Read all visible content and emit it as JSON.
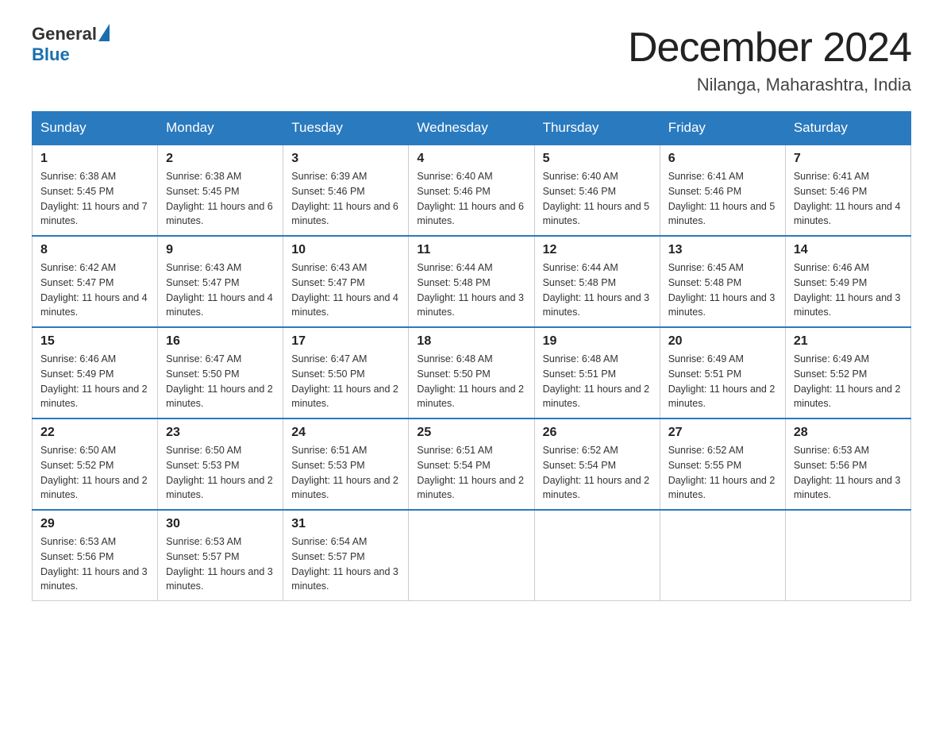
{
  "logo": {
    "text_general": "General",
    "text_blue": "Blue",
    "triangle_decoration": "▶"
  },
  "title": {
    "month_year": "December 2024",
    "location": "Nilanga, Maharashtra, India"
  },
  "weekdays": [
    "Sunday",
    "Monday",
    "Tuesday",
    "Wednesday",
    "Thursday",
    "Friday",
    "Saturday"
  ],
  "weeks": [
    [
      {
        "day": "1",
        "sunrise": "6:38 AM",
        "sunset": "5:45 PM",
        "daylight": "11 hours and 7 minutes."
      },
      {
        "day": "2",
        "sunrise": "6:38 AM",
        "sunset": "5:45 PM",
        "daylight": "11 hours and 6 minutes."
      },
      {
        "day": "3",
        "sunrise": "6:39 AM",
        "sunset": "5:46 PM",
        "daylight": "11 hours and 6 minutes."
      },
      {
        "day": "4",
        "sunrise": "6:40 AM",
        "sunset": "5:46 PM",
        "daylight": "11 hours and 6 minutes."
      },
      {
        "day": "5",
        "sunrise": "6:40 AM",
        "sunset": "5:46 PM",
        "daylight": "11 hours and 5 minutes."
      },
      {
        "day": "6",
        "sunrise": "6:41 AM",
        "sunset": "5:46 PM",
        "daylight": "11 hours and 5 minutes."
      },
      {
        "day": "7",
        "sunrise": "6:41 AM",
        "sunset": "5:46 PM",
        "daylight": "11 hours and 4 minutes."
      }
    ],
    [
      {
        "day": "8",
        "sunrise": "6:42 AM",
        "sunset": "5:47 PM",
        "daylight": "11 hours and 4 minutes."
      },
      {
        "day": "9",
        "sunrise": "6:43 AM",
        "sunset": "5:47 PM",
        "daylight": "11 hours and 4 minutes."
      },
      {
        "day": "10",
        "sunrise": "6:43 AM",
        "sunset": "5:47 PM",
        "daylight": "11 hours and 4 minutes."
      },
      {
        "day": "11",
        "sunrise": "6:44 AM",
        "sunset": "5:48 PM",
        "daylight": "11 hours and 3 minutes."
      },
      {
        "day": "12",
        "sunrise": "6:44 AM",
        "sunset": "5:48 PM",
        "daylight": "11 hours and 3 minutes."
      },
      {
        "day": "13",
        "sunrise": "6:45 AM",
        "sunset": "5:48 PM",
        "daylight": "11 hours and 3 minutes."
      },
      {
        "day": "14",
        "sunrise": "6:46 AM",
        "sunset": "5:49 PM",
        "daylight": "11 hours and 3 minutes."
      }
    ],
    [
      {
        "day": "15",
        "sunrise": "6:46 AM",
        "sunset": "5:49 PM",
        "daylight": "11 hours and 2 minutes."
      },
      {
        "day": "16",
        "sunrise": "6:47 AM",
        "sunset": "5:50 PM",
        "daylight": "11 hours and 2 minutes."
      },
      {
        "day": "17",
        "sunrise": "6:47 AM",
        "sunset": "5:50 PM",
        "daylight": "11 hours and 2 minutes."
      },
      {
        "day": "18",
        "sunrise": "6:48 AM",
        "sunset": "5:50 PM",
        "daylight": "11 hours and 2 minutes."
      },
      {
        "day": "19",
        "sunrise": "6:48 AM",
        "sunset": "5:51 PM",
        "daylight": "11 hours and 2 minutes."
      },
      {
        "day": "20",
        "sunrise": "6:49 AM",
        "sunset": "5:51 PM",
        "daylight": "11 hours and 2 minutes."
      },
      {
        "day": "21",
        "sunrise": "6:49 AM",
        "sunset": "5:52 PM",
        "daylight": "11 hours and 2 minutes."
      }
    ],
    [
      {
        "day": "22",
        "sunrise": "6:50 AM",
        "sunset": "5:52 PM",
        "daylight": "11 hours and 2 minutes."
      },
      {
        "day": "23",
        "sunrise": "6:50 AM",
        "sunset": "5:53 PM",
        "daylight": "11 hours and 2 minutes."
      },
      {
        "day": "24",
        "sunrise": "6:51 AM",
        "sunset": "5:53 PM",
        "daylight": "11 hours and 2 minutes."
      },
      {
        "day": "25",
        "sunrise": "6:51 AM",
        "sunset": "5:54 PM",
        "daylight": "11 hours and 2 minutes."
      },
      {
        "day": "26",
        "sunrise": "6:52 AM",
        "sunset": "5:54 PM",
        "daylight": "11 hours and 2 minutes."
      },
      {
        "day": "27",
        "sunrise": "6:52 AM",
        "sunset": "5:55 PM",
        "daylight": "11 hours and 2 minutes."
      },
      {
        "day": "28",
        "sunrise": "6:53 AM",
        "sunset": "5:56 PM",
        "daylight": "11 hours and 3 minutes."
      }
    ],
    [
      {
        "day": "29",
        "sunrise": "6:53 AM",
        "sunset": "5:56 PM",
        "daylight": "11 hours and 3 minutes."
      },
      {
        "day": "30",
        "sunrise": "6:53 AM",
        "sunset": "5:57 PM",
        "daylight": "11 hours and 3 minutes."
      },
      {
        "day": "31",
        "sunrise": "6:54 AM",
        "sunset": "5:57 PM",
        "daylight": "11 hours and 3 minutes."
      },
      null,
      null,
      null,
      null
    ]
  ]
}
